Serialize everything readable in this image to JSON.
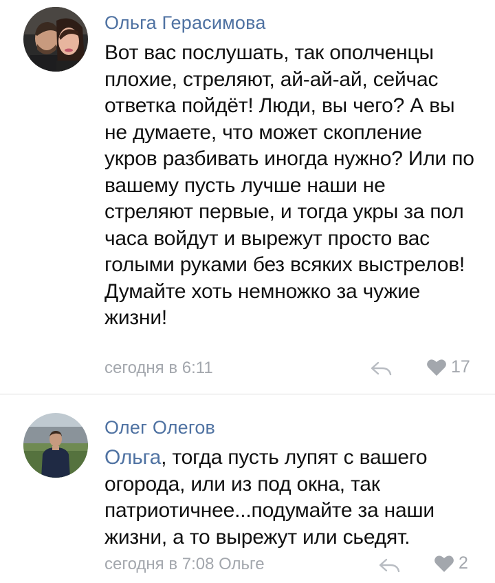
{
  "comments": [
    {
      "author": "Ольга Герасимова",
      "avatar_icon": "avatar-couple-photo",
      "text": "Вот вас послушать, так ополченцы плохие, стреляют, ай-ай-ай, сейчас ответка пойдёт! Люди, вы чего? А вы не думаете, что может скопление укров разбивать иногда нужно? Или по вашему пусть лучше наши не стреляют первые, и тогда укры за пол часа войдут и вырежут просто вас голыми руками без всяких выстрелов! Думайте хоть немножко за чужие жизни!",
      "time": "сегодня в 6:11",
      "likes": "17"
    },
    {
      "author": "Олег Олегов",
      "avatar_icon": "avatar-man-photo",
      "mention": "Ольга",
      "text": ", тогда пусть лупят с вашего огорода, или из под окна, так патриотичнее...подумайте за наши жизни, а то вырежут или сьедят.",
      "time": "сегодня в 7:08 Ольге",
      "likes": "2"
    }
  ],
  "colors": {
    "author": "#4f72a2",
    "text": "#111111",
    "meta": "#a3a7ad",
    "divider": "#dcdcdc"
  },
  "icons": {
    "reply": "reply-icon",
    "like": "heart-icon"
  }
}
